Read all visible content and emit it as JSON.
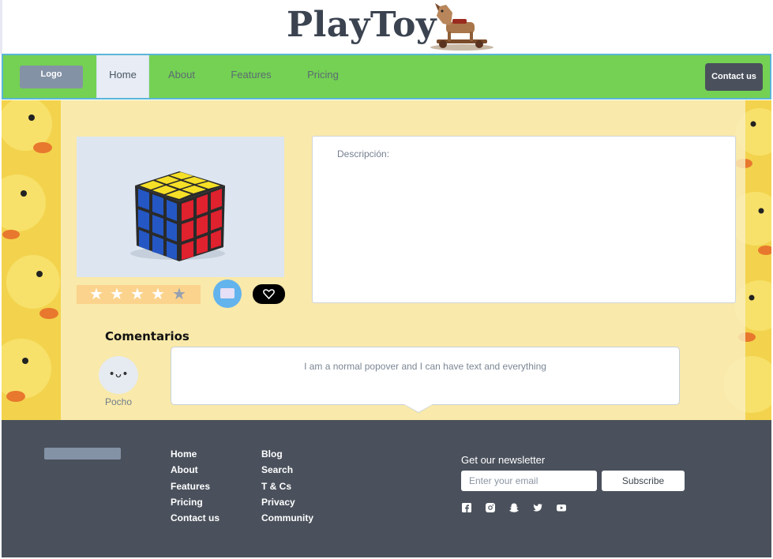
{
  "header": {
    "brand": "PlayToy",
    "logo_icon": "rocking-horse-icon"
  },
  "navbar": {
    "logo_label": "Logo",
    "items": [
      {
        "label": "Home",
        "active": true
      },
      {
        "label": "About",
        "active": false
      },
      {
        "label": "Features",
        "active": false
      },
      {
        "label": "Pricing",
        "active": false
      }
    ],
    "contact_label": "Contact us",
    "accent": "#74d153"
  },
  "product": {
    "image_icon": "rubiks-cube-icon",
    "rating": {
      "value": 4,
      "max": 5
    },
    "cart_icon": "cart-icon",
    "favorite_icon": "heart-icon",
    "description_label": "Descripción:"
  },
  "comments": {
    "title": "Comentarios",
    "items": [
      {
        "avatar_face": "•ᴗ•",
        "author": "Pocho",
        "text": "I am a normal popover and I can have text and everything"
      }
    ]
  },
  "footer": {
    "col1": [
      "Home",
      "About",
      "Features",
      "Pricing",
      "Contact us"
    ],
    "col2": [
      "Blog",
      "Search",
      "T & Cs",
      "Privacy",
      "Community"
    ],
    "newsletter_title": "Get our newsletter",
    "email_placeholder": "Enter your email",
    "subscribe_label": "Subscribe",
    "social_icons": [
      "facebook-icon",
      "instagram-icon",
      "snapchat-icon",
      "twitter-icon",
      "youtube-icon"
    ]
  }
}
